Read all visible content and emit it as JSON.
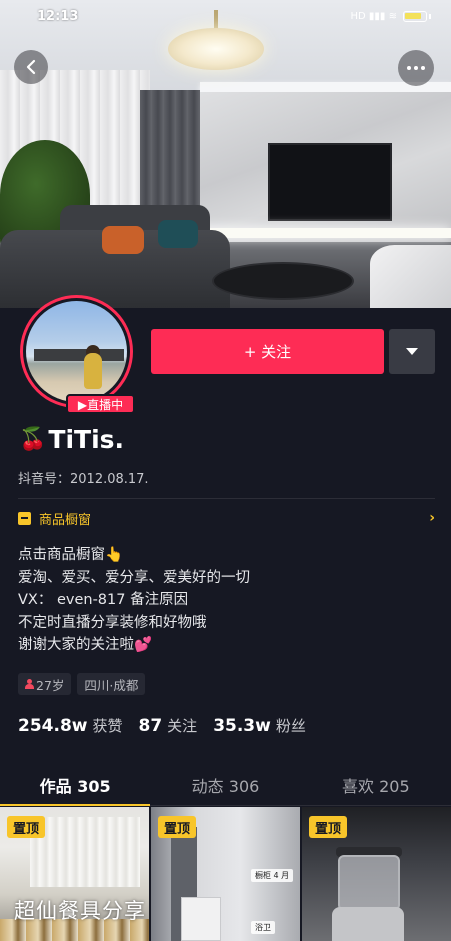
{
  "status_bar": {
    "time": "12:13",
    "signal": "HD ▮▮▮ ≋"
  },
  "profile": {
    "live_badge": "▶直播中",
    "follow_label": "+ 关注",
    "nickname_emoji": "🍒",
    "nickname": "TiTis.",
    "douyin_id": "抖音号：2012.08.17.",
    "shop_label": "商品橱窗",
    "bio_lines": [
      "点击商品橱窗👆",
      "爱淘、爱买、爱分享、爱美好的一切",
      "VX： even-817   备注原因",
      "不定时直播分享装修和好物哦",
      "谢谢大家的关注啦💕"
    ],
    "tags": {
      "age": "27岁",
      "location": "四川·成都"
    },
    "stats": [
      {
        "num": "254.8w",
        "label": "获赞"
      },
      {
        "num": "87",
        "label": "关注"
      },
      {
        "num": "35.3w",
        "label": "粉丝"
      }
    ]
  },
  "tabs": [
    {
      "label": "作品 305",
      "active": true
    },
    {
      "label": "动态 306",
      "active": false
    },
    {
      "label": "喜欢 205",
      "active": false
    }
  ],
  "videos": [
    {
      "pin": "置顶",
      "caption": "超仙餐具分享"
    },
    {
      "pin": "置顶",
      "labels": [
        "橱柜 4 月",
        "浴卫"
      ]
    },
    {
      "pin": "置顶"
    }
  ],
  "colors": {
    "accent": "#fe2c55",
    "gold": "#f8c52a",
    "background": "#161823"
  },
  "icons": {
    "back": "chevron-left-icon",
    "more": "more-dots-icon",
    "shop": "shop-icon",
    "dropdown": "caret-down-icon"
  }
}
